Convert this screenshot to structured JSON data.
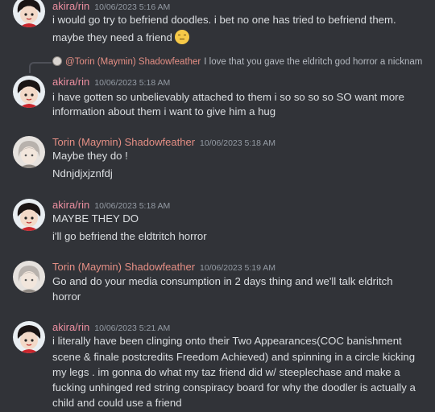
{
  "messages": [
    {
      "author": "akira/rin",
      "timestamp": "10/06/2023 5:16 AM",
      "lines": [
        "i would go try to befriend doodles. i bet no one has tried to befriend them.",
        "maybe they need a friend"
      ],
      "emoji": "pensive-face"
    },
    {
      "reply_to": {
        "author": "@Torin (Maymin) Shadowfeather",
        "text": "I love that you gave the eldritch god horror a nicknam"
      },
      "author": "akira/rin",
      "timestamp": "10/06/2023 5:18 AM",
      "lines": [
        "i have gotten so unbelievably attached to them i so so so so SO want more",
        "information about them i want to give him a hug"
      ]
    },
    {
      "author": "Torin (Maymin) Shadowfeather",
      "timestamp": "10/06/2023 5:18 AM",
      "lines": [
        "Maybe they do !",
        "Ndnjdjxjznfdj"
      ]
    },
    {
      "author": "akira/rin",
      "timestamp": "10/06/2023 5:18 AM",
      "lines": [
        "MAYBE THEY DO",
        "i'll go befriend the eldtritch horror"
      ]
    },
    {
      "author": "Torin (Maymin) Shadowfeather",
      "timestamp": "10/06/2023 5:19 AM",
      "lines": [
        "Go and do your media consumption in 2 days thing and we'll talk eldritch",
        "horror"
      ]
    },
    {
      "author": "akira/rin",
      "timestamp": "10/06/2023 5:21 AM",
      "lines": [
        "i literally have been clinging onto their Two Appearances(COC banishment",
        "scene & finale postcredits Freedom Achieved) and spinning in a circle kicking",
        "my legs . im gonna do what my taz friend did w/ steeplechase and make a",
        "fucking unhinged red string conspiracy board for why the doodler is actually a",
        "child and could use a friend"
      ]
    }
  ]
}
